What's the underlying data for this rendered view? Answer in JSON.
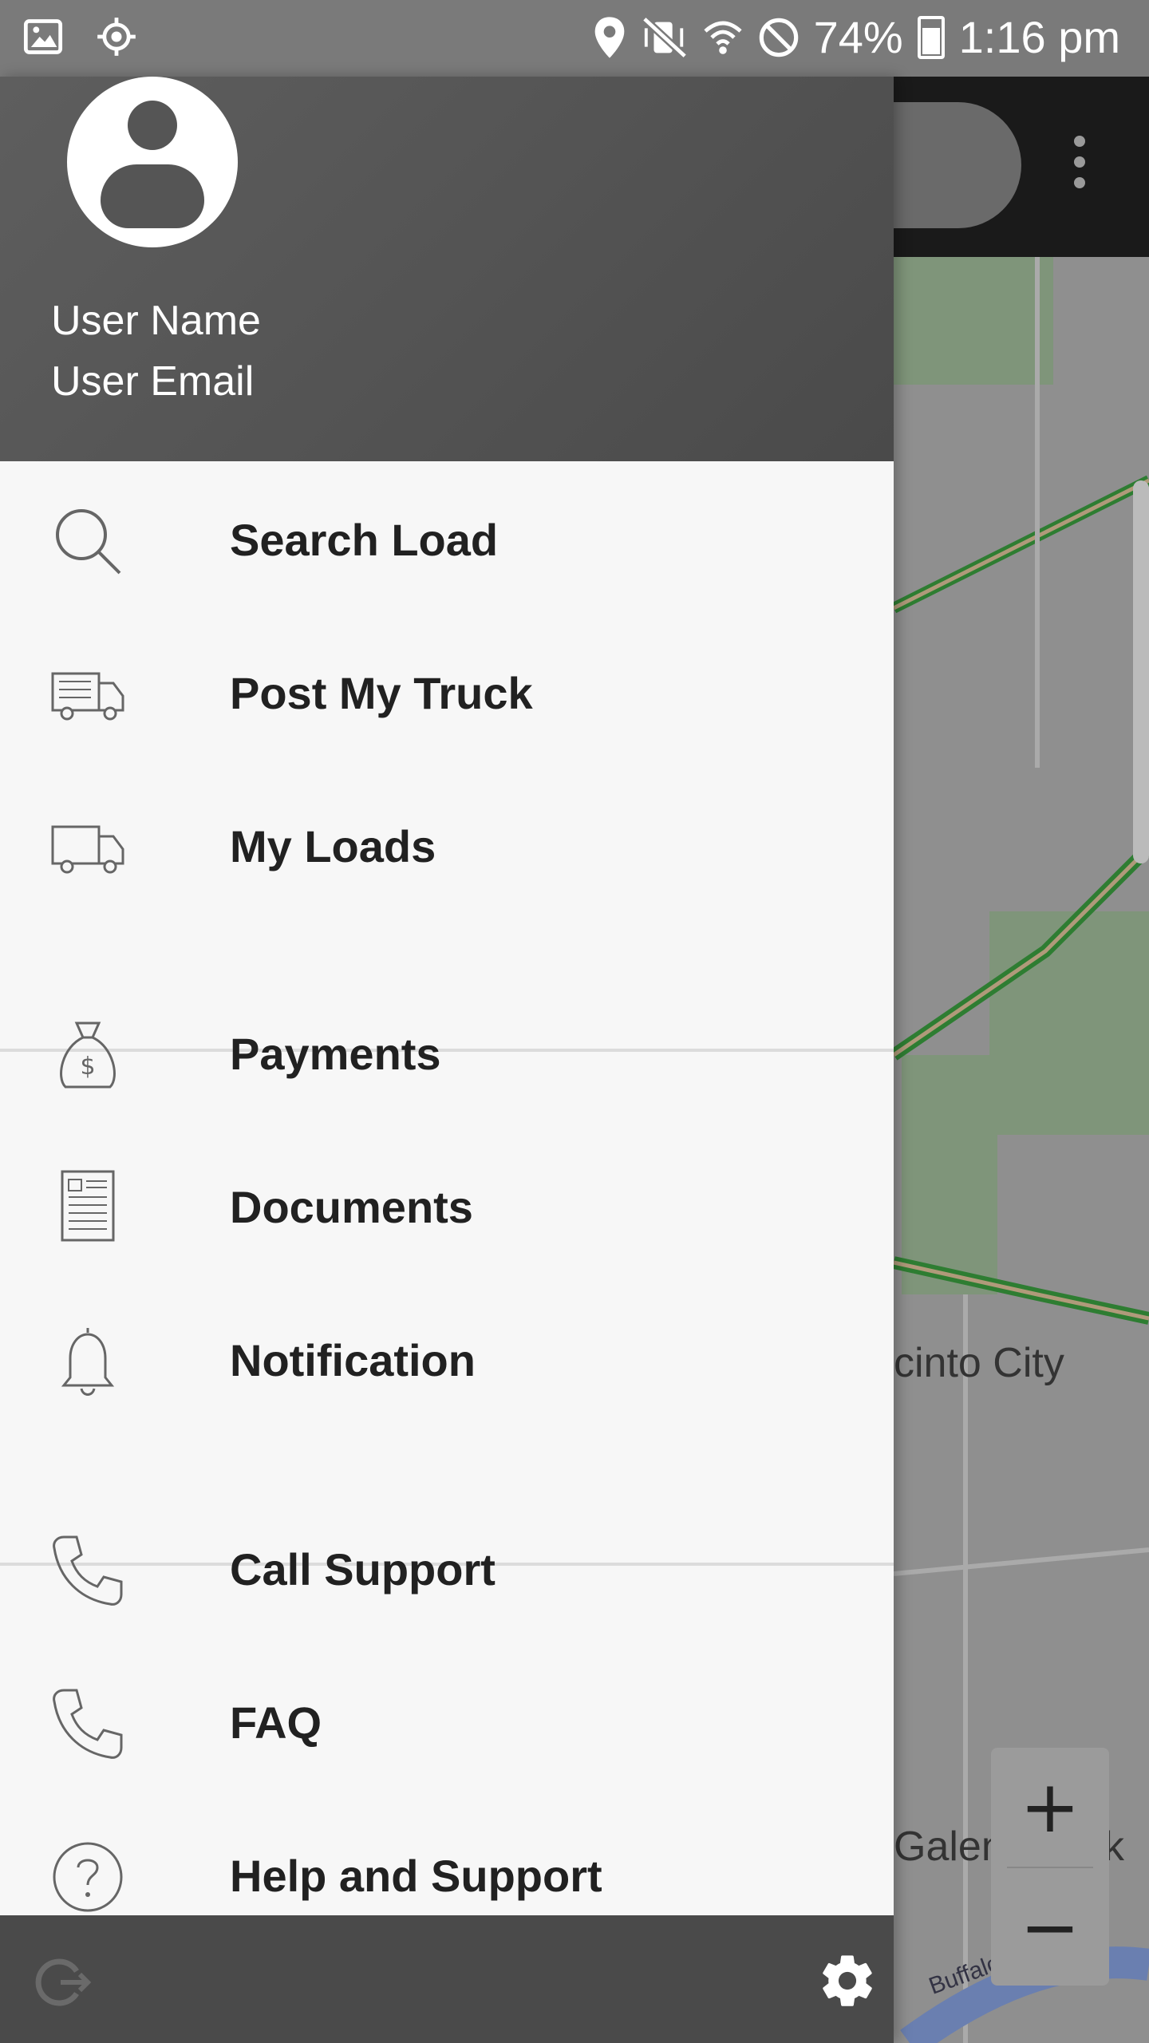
{
  "status_bar": {
    "battery": "74%",
    "time": "1:16 pm",
    "icons": [
      "image-icon",
      "location-target-icon",
      "location-pin-icon",
      "vibrate-mute-icon",
      "wifi-icon",
      "do-not-disturb-icon",
      "battery-icon"
    ]
  },
  "map": {
    "labels": [
      "cinto City",
      "Galena Park",
      "Buffalo Bayou"
    ],
    "zoom_in": "+",
    "zoom_out": "−"
  },
  "drawer": {
    "user_name": "User Name",
    "user_email": "User Email",
    "menu": [
      {
        "label": "Search Load",
        "icon": "search-icon"
      },
      {
        "label": "Post My Truck",
        "icon": "truck-icon"
      },
      {
        "label": "My Loads",
        "icon": "truck-icon"
      },
      {
        "label": "Payments",
        "icon": "money-bag-icon"
      },
      {
        "label": "Documents",
        "icon": "document-icon"
      },
      {
        "label": "Notification",
        "icon": "bell-icon"
      },
      {
        "label": "Call Support",
        "icon": "phone-icon"
      },
      {
        "label": "FAQ",
        "icon": "phone-icon"
      },
      {
        "label": "Help and Support",
        "icon": "help-icon"
      }
    ],
    "footer": {
      "left_icon": "logout-icon",
      "right_icon": "settings-icon"
    }
  },
  "colors": {
    "drawer_header": "#555555",
    "drawer_bg": "#f7f7f7",
    "footer_bg": "#4a4a4a",
    "map_road_green": "#2e7d32",
    "map_green": "#6a8a5a"
  }
}
